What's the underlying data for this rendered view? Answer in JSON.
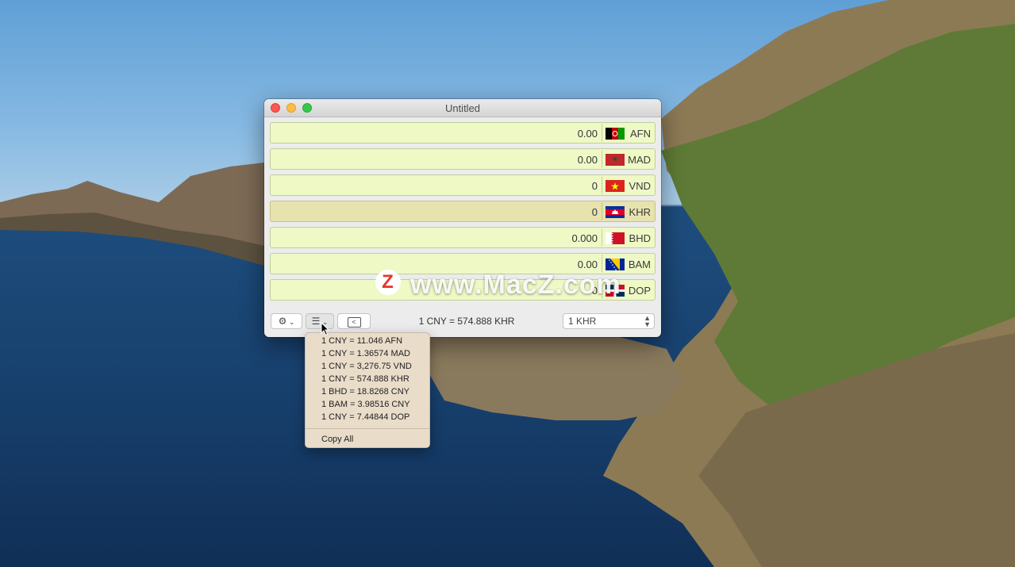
{
  "window": {
    "title": "Untitled"
  },
  "rows": [
    {
      "amount": "0.00",
      "code": "AFN",
      "flag": "afghanistan-flag"
    },
    {
      "amount": "0.00",
      "code": "MAD",
      "flag": "morocco-flag"
    },
    {
      "amount": "0",
      "code": "VND",
      "flag": "vietnam-flag"
    },
    {
      "amount": "0",
      "code": "KHR",
      "flag": "cambodia-flag"
    },
    {
      "amount": "0.000",
      "code": "BHD",
      "flag": "bahrain-flag"
    },
    {
      "amount": "0.00",
      "code": "BAM",
      "flag": "bosnia-flag"
    },
    {
      "amount": "0",
      "code": "DOP",
      "flag": "dominican-flag"
    }
  ],
  "toolbar": {
    "rate_text": "1 CNY = 574.888 KHR",
    "select_value": "1 KHR"
  },
  "menu": {
    "items": [
      "1 CNY = 11.046 AFN",
      "1 CNY = 1.36574 MAD",
      "1 CNY = 3,276.75 VND",
      "1 CNY = 574.888 KHR",
      "1 BHD = 18.8268 CNY",
      "1 BAM = 3.98516 CNY",
      "1 CNY = 7.44844 DOP"
    ],
    "copy_all": "Copy All"
  },
  "watermark": {
    "logo": "Z",
    "text": "www.MacZ.com"
  },
  "colors": {
    "row_bg": "#eef9c6",
    "row_active_bg": "#e7e3ae",
    "menu_bg": "#e9dcc9"
  }
}
